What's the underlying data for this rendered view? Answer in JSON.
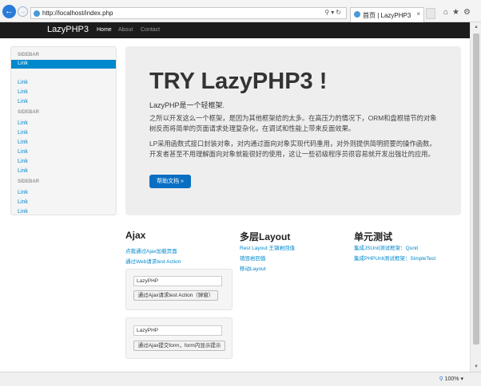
{
  "browser": {
    "url": "http://localhost/index.php",
    "tab_title": "首页 | LazyPHP3",
    "zoom": "100%"
  },
  "navbar": {
    "brand": "LazyPHP3",
    "items": [
      "Home",
      "About",
      "Contact"
    ]
  },
  "sidebar": {
    "groups": [
      {
        "header": "SIDEBAR",
        "links": [
          "Link",
          "Link",
          "Link",
          "Link"
        ]
      },
      {
        "header": "SIDEBAR",
        "links": [
          "Link",
          "Link",
          "Link",
          "Link",
          "Link",
          "Link"
        ]
      },
      {
        "header": "SIDEBAR",
        "links": [
          "Link",
          "Link",
          "Link"
        ]
      }
    ]
  },
  "hero": {
    "title": "TRY LazyPHP3 !",
    "lead": "LazyPHP是一个轻框架.",
    "para1": "之所以开发这么一个框架，是因为其他框架给的太多。在高压力的情况下，ORM和盘根错节的对象树反而将简单的页面请求处理复杂化，在调试和性能上带来反面效果。",
    "para2": "LP采用函数式接口封装对象，对内通过面向对象实现代码重用，对外则提供简明扼要的操作函数。开发者甚至不用理解面向对象就能很好的使用，这让一些初级程序员很容易就开发出强壮的应用。",
    "button": "帮助文档 »"
  },
  "columns": {
    "ajax": {
      "title": "Ajax",
      "links": [
        "点我通过Ajax加载页面",
        "通过Web请求test Action"
      ]
    },
    "layout": {
      "title": "多层Layout",
      "links": [
        "Rest Layout 王镇岩回值",
        "销毁岩回值",
        "移动Layout"
      ]
    },
    "unit": {
      "title": "单元测试",
      "links": [
        "集成JSUnit测试框架：Qunit",
        "集成PHPUnit测试框架：SimpleTest"
      ]
    }
  },
  "forms": {
    "form1": {
      "value": "LazyPHP",
      "button": "通过Ajax请求test Action（弹窗）"
    },
    "form2": {
      "value": "LazyPHP",
      "button": "通过Ajax提交form，form内显示提示"
    }
  }
}
